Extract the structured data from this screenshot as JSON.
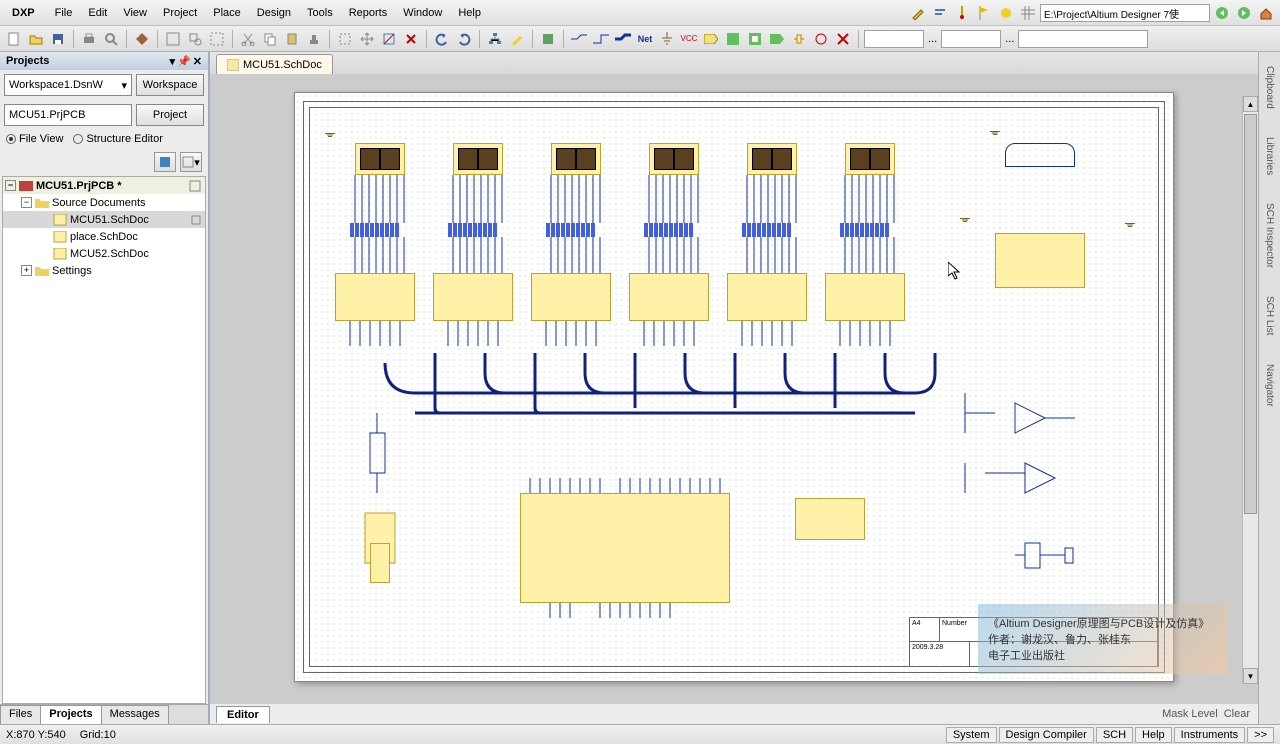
{
  "menu": {
    "dxp": "DXP",
    "items": [
      "File",
      "Edit",
      "View",
      "Project",
      "Place",
      "Design",
      "Tools",
      "Reports",
      "Window",
      "Help"
    ],
    "path": "E:\\Project\\Altium Designer 7使"
  },
  "panels": {
    "title": "Projects",
    "workspace": "Workspace1.DsnW",
    "ws_btn": "Workspace",
    "project_field": "MCU51.PrjPCB",
    "prj_btn": "Project",
    "view1": "File View",
    "view2": "Structure Editor"
  },
  "tree": {
    "root": "MCU51.PrjPCB *",
    "src": "Source Documents",
    "docs": [
      "MCU51.SchDoc",
      "place.SchDoc",
      "MCU52.SchDoc"
    ],
    "settings": "Settings"
  },
  "bottom_tabs": [
    "Files",
    "Projects",
    "Messages"
  ],
  "doc_tab": "MCU51.SchDoc",
  "editor_tab": "Editor",
  "mask": "Mask Level",
  "clear": "Clear",
  "status": {
    "coord": "X:870 Y:540",
    "grid": "Grid:10",
    "btns": [
      "System",
      "Design Compiler",
      "SCH",
      "Help",
      "Instruments",
      ">>"
    ]
  },
  "right_tabs": [
    "Clipboard",
    "Libraries",
    "SCH Inspector",
    "SCH List",
    "Navigator"
  ],
  "watermark": {
    "l1": "《Altium Designer原理图与PCB设计及仿真》",
    "l2": "作者：谢龙汉、鲁力、张桂东",
    "l3": "电子工业出版社"
  },
  "titleblock": {
    "size": "A4",
    "num": "Number",
    "date": "2009.3.28"
  }
}
